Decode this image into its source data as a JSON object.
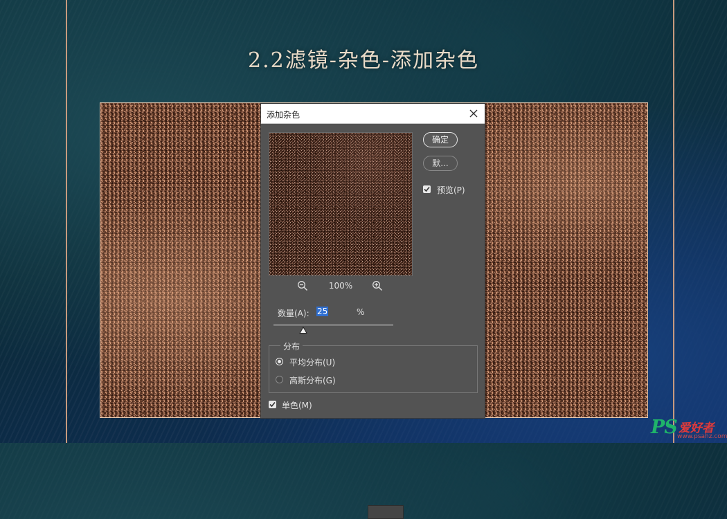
{
  "page": {
    "title": "2.2滤镜-杂色-添加杂色"
  },
  "dialog": {
    "title": "添加杂色",
    "ok_label": "确定",
    "default_label": "默...",
    "preview_label": "预览(P)",
    "preview_checked": true,
    "zoom_level": "100%",
    "amount_label": "数量(A):",
    "amount_value": "25",
    "amount_unit": "%",
    "amount_slider_fraction": 0.25,
    "distribution": {
      "legend": "分布",
      "uniform_label": "平均分布(U)",
      "gaussian_label": "高斯分布(G)",
      "selected": "uniform"
    },
    "monochrome_label": "单色(M)",
    "monochrome_checked": true
  },
  "watermark": {
    "logo": "PS",
    "text": "爱好者",
    "url": "www.psahz.com"
  },
  "colors": {
    "frame_line": "#c79a7e",
    "dialog_bg": "#535353",
    "canvas_brown": "#6e4330",
    "selection_blue": "#2f6fd1",
    "watermark_green": "#1fb36a",
    "watermark_red": "#e03a3a"
  },
  "icons": {
    "close": "close-icon",
    "zoom_out": "zoom-out-icon",
    "zoom_in": "zoom-in-icon",
    "slider_thumb": "triangle-thumb-icon",
    "checkmark": "checkmark-icon"
  }
}
